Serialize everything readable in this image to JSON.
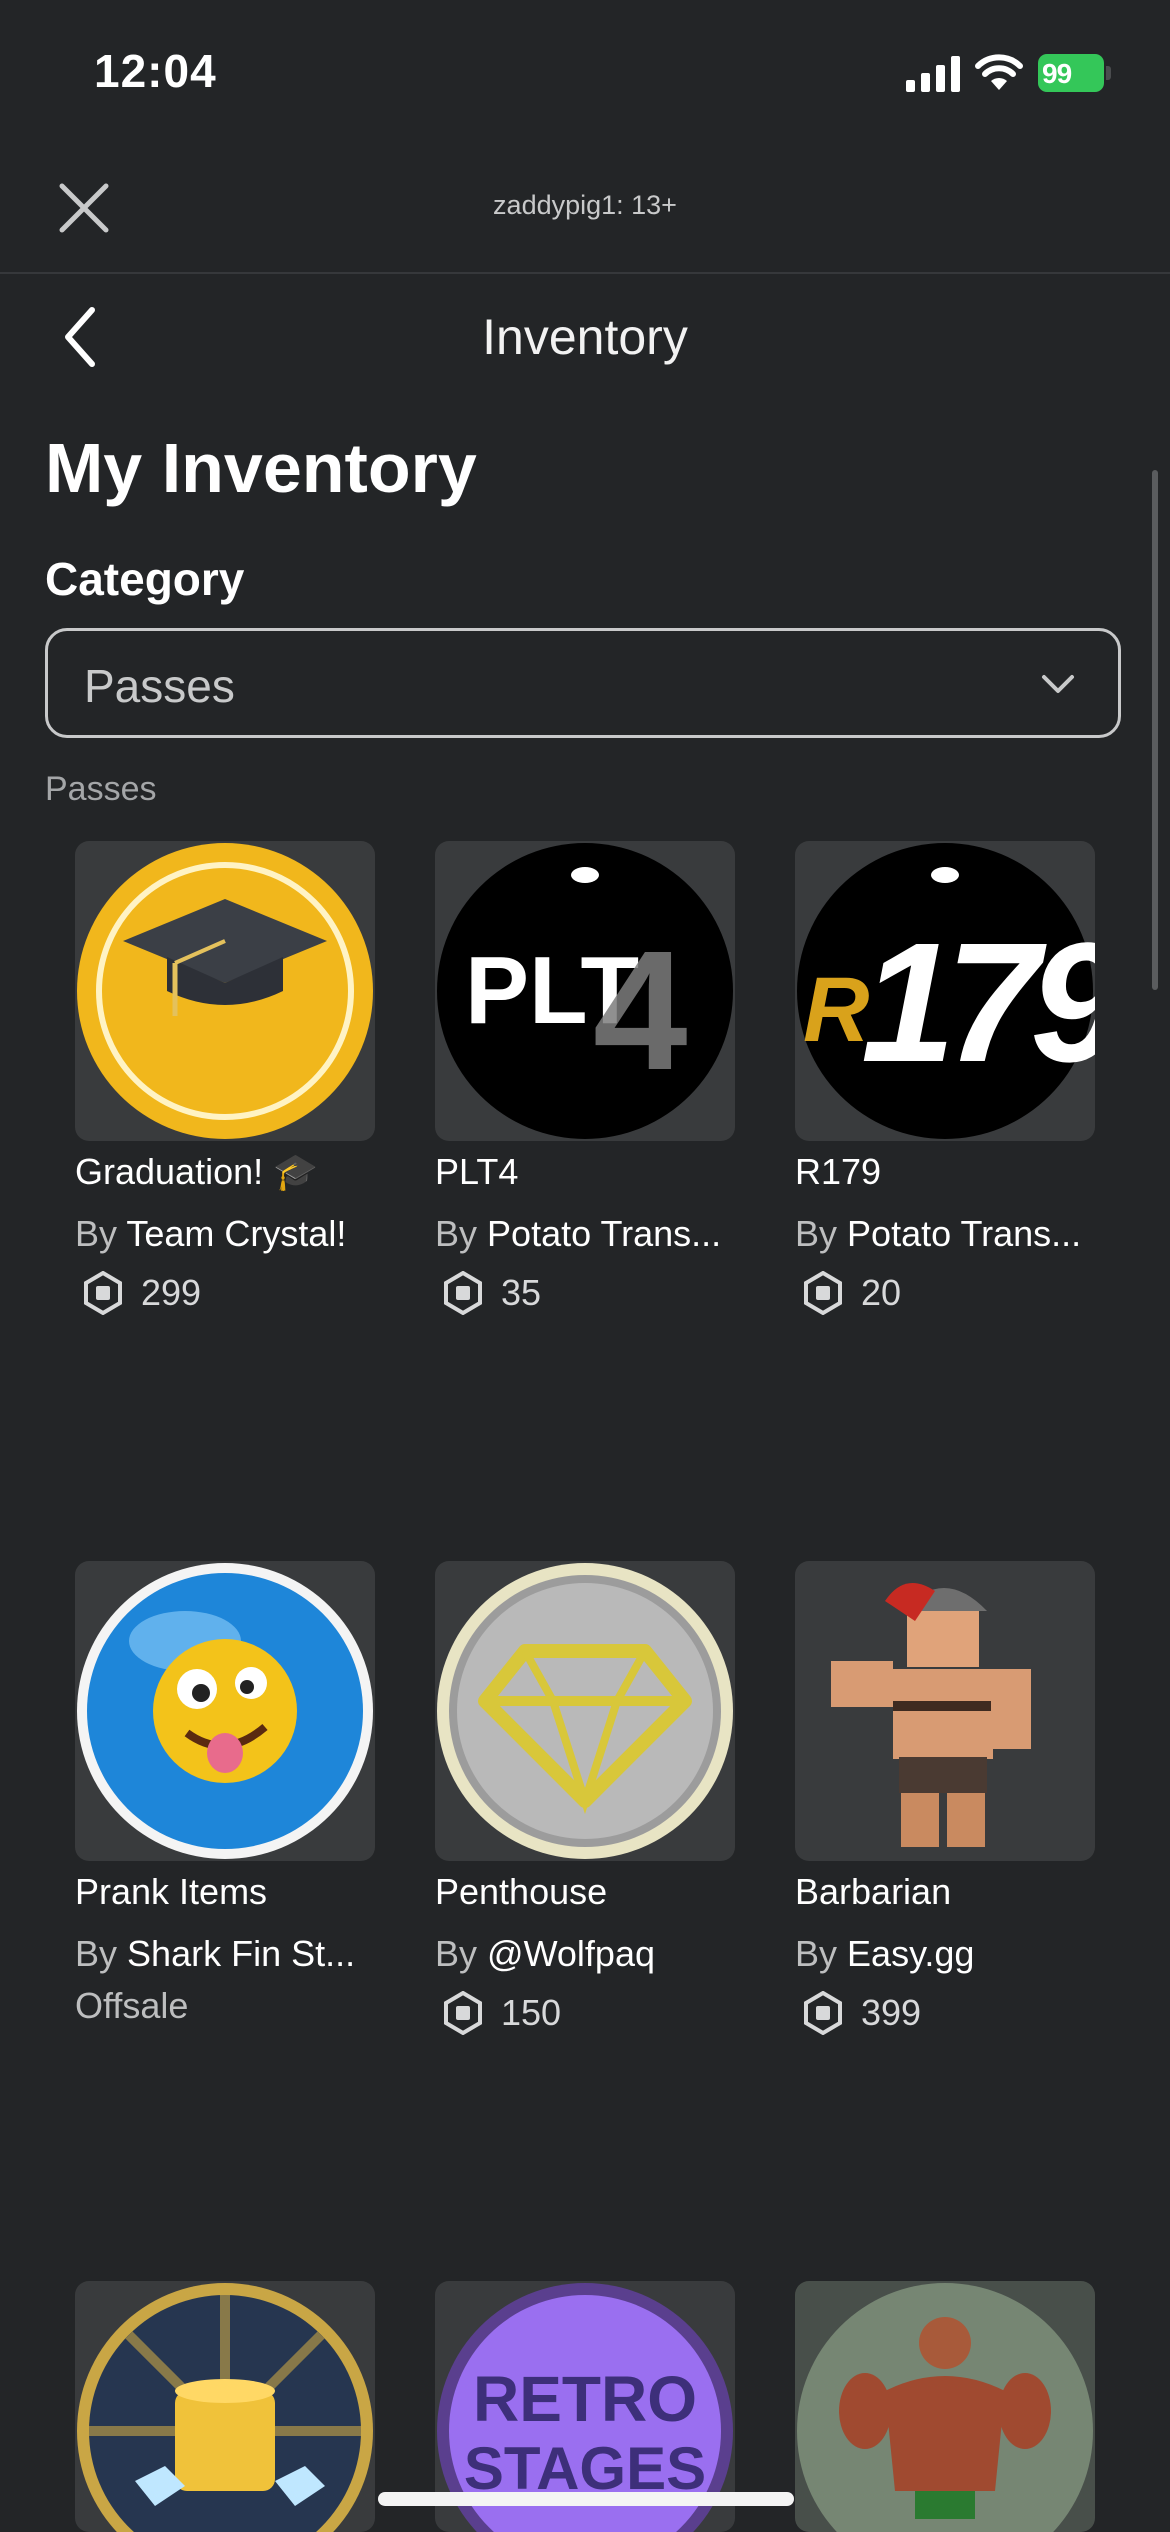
{
  "status_bar": {
    "time": "12:04",
    "battery": "99"
  },
  "header": {
    "username": "zaddypig1: 13+"
  },
  "nav": {
    "title": "Inventory"
  },
  "page": {
    "heading": "My Inventory",
    "category_label": "Category",
    "category_value": "Passes",
    "section_label": "Passes"
  },
  "colors": {
    "background": "#232527",
    "tile": "#393b3d",
    "battery": "#34c759"
  },
  "items": [
    {
      "name": "Graduation! 🎓",
      "by": "By",
      "creator": "Team Crystal!",
      "price": "299",
      "icon": "graduation-cap-icon"
    },
    {
      "name": "PLT4",
      "by": "By",
      "creator": "Potato Trans...",
      "price": "35",
      "icon": "plt4-logo"
    },
    {
      "name": "R179",
      "by": "By",
      "creator": "Potato Trans...",
      "price": "20",
      "icon": "r179-logo"
    },
    {
      "name": "Prank Items",
      "by": "By",
      "creator": "Shark Fin St...",
      "status": "Offsale",
      "icon": "crazy-face-icon"
    },
    {
      "name": "Penthouse",
      "by": "By",
      "creator": "@Wolfpaq",
      "price": "150",
      "icon": "diamond-icon"
    },
    {
      "name": "Barbarian",
      "by": "By",
      "creator": "Easy.gg",
      "price": "399",
      "icon": "barbarian-avatar"
    },
    {
      "icon": "coins-icon"
    },
    {
      "label": "RETRO STAGES",
      "label_line1": "RETRO",
      "label_line2": "STAGES",
      "icon": "retro-stages-badge"
    },
    {
      "icon": "bodybuilder-image"
    }
  ]
}
